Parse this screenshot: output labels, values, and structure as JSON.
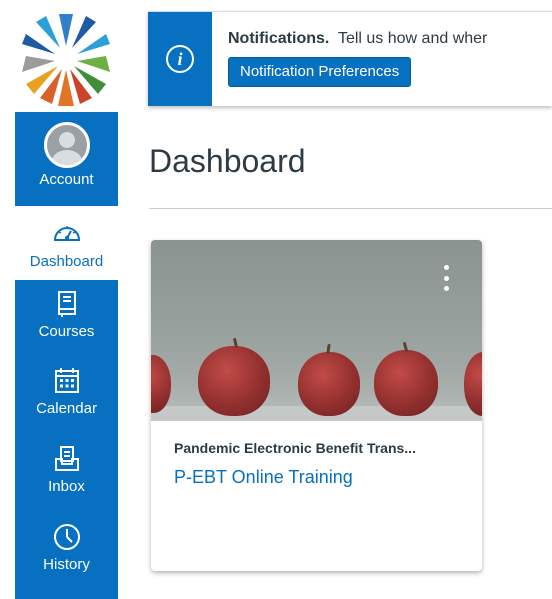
{
  "nav": {
    "logo_icon": "star-logo-icon",
    "items": [
      {
        "label": "Account",
        "icon": "avatar-icon"
      },
      {
        "label": "Dashboard",
        "icon": "dashboard-icon"
      },
      {
        "label": "Courses",
        "icon": "book-icon"
      },
      {
        "label": "Calendar",
        "icon": "calendar-icon"
      },
      {
        "label": "Inbox",
        "icon": "inbox-icon"
      },
      {
        "label": "History",
        "icon": "clock-icon"
      }
    ]
  },
  "banner": {
    "title": "Notifications.",
    "text": "Tell us how and wher",
    "button_label": "Notification Preferences",
    "icon": "info-icon"
  },
  "page": {
    "title": "Dashboard"
  },
  "card": {
    "title": "Pandemic Electronic Benefit Trans...",
    "subtitle": "P-EBT Online Training",
    "menu_icon": "kebab-menu-icon"
  },
  "colors": {
    "accent": "#0770c0",
    "text": "#2d3b45"
  }
}
